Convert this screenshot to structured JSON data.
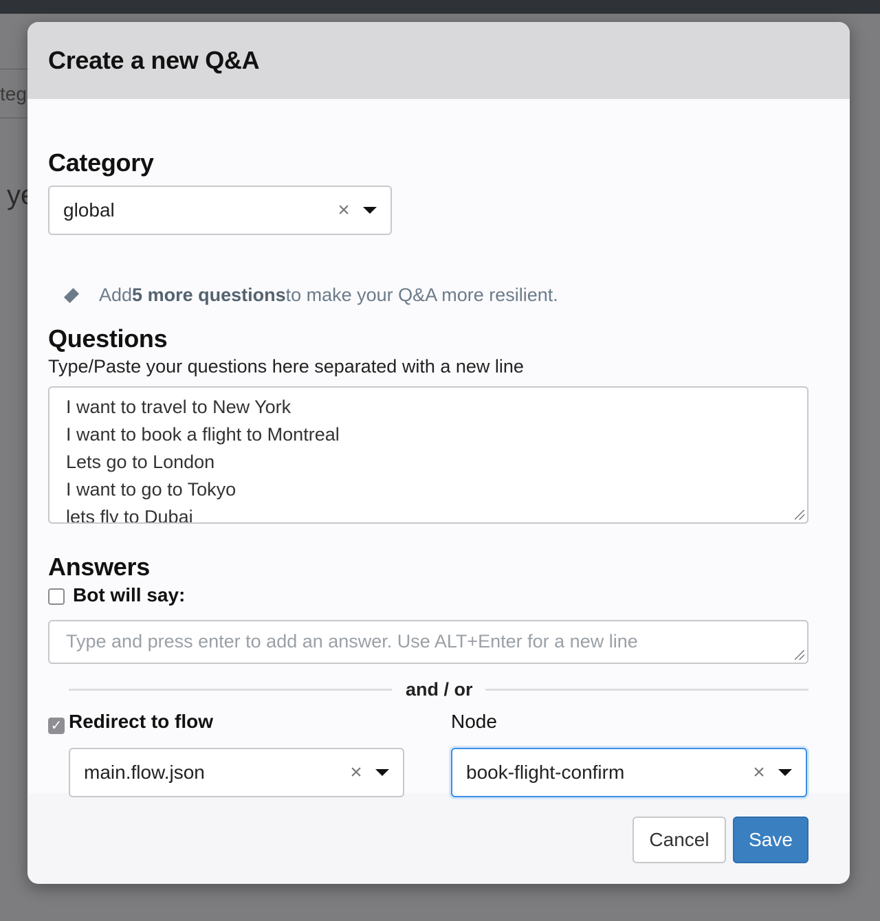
{
  "background": {
    "input_fragment": "teg",
    "text_fragment": "ye"
  },
  "modal": {
    "title": "Create a new Q&A",
    "category": {
      "label": "Category",
      "selected": "global",
      "clear_glyph": "×"
    },
    "hint": {
      "prefix": "Add ",
      "highlight": "5 more questions",
      "suffix": " to make your Q&A more resilient."
    },
    "questions": {
      "label": "Questions",
      "subtext": "Type/Paste your questions here separated with a new line",
      "lines": [
        "I want to travel to New York",
        "I want to book a flight to Montreal",
        "Lets go to London",
        "I want to go to Tokyo",
        "lets fly to Dubai"
      ]
    },
    "answers": {
      "label": "Answers",
      "bot_will_say": {
        "label": "Bot will say:",
        "checked": false
      },
      "placeholder": "Type and press enter to add an answer. Use ALT+Enter for a new line"
    },
    "divider": "and / or",
    "redirect": {
      "label": "Redirect to flow",
      "checked": true,
      "check_glyph": "✓",
      "flow_selected": "main.flow.json",
      "node_label": "Node",
      "node_selected": "book-flight-confirm",
      "clear_glyph": "×"
    },
    "footer": {
      "cancel": "Cancel",
      "save": "Save"
    }
  },
  "colors": {
    "primary": "#3a7fc0",
    "hint": "#6c7b8a",
    "focus": "#3a8ee6"
  },
  "icons": [
    "close-icon",
    "chevron-down-icon",
    "diamond-icon",
    "checkmark-icon",
    "resize-handle-icon"
  ]
}
